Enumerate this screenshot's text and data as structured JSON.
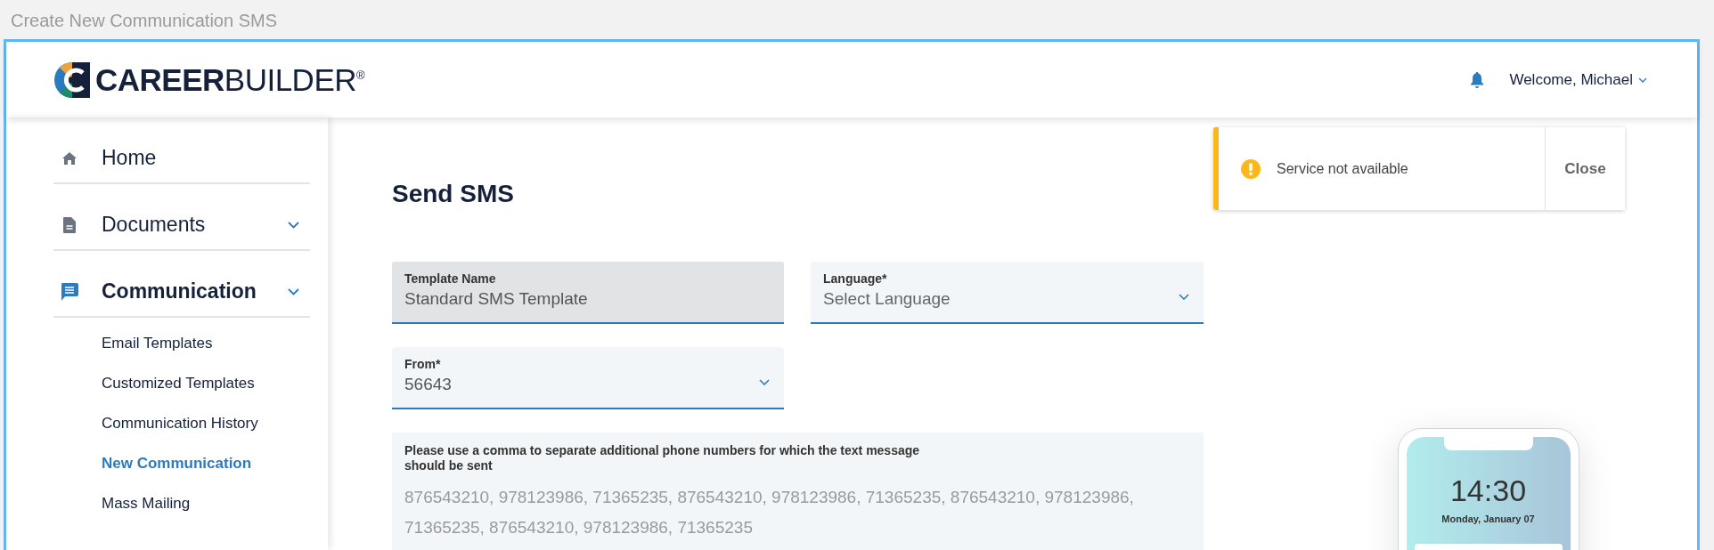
{
  "page_title": "Create New Communication SMS",
  "header": {
    "logo": {
      "bold": "CAREER",
      "light": "BUILDER",
      "mark": "®"
    },
    "user_menu": "Welcome, Michael"
  },
  "sidebar": {
    "items": [
      {
        "label": "Home",
        "kind": "home",
        "selected": false,
        "expandable": false
      },
      {
        "label": "Documents",
        "kind": "document",
        "selected": false,
        "expandable": true
      },
      {
        "label": "Communication",
        "kind": "chat",
        "selected": true,
        "expandable": true,
        "children": [
          {
            "label": "Email Templates",
            "selected": false
          },
          {
            "label": "Customized Templates",
            "selected": false
          },
          {
            "label": "Communication History",
            "selected": false
          },
          {
            "label": "New Communication",
            "selected": true
          },
          {
            "label": "Mass Mailing",
            "selected": false
          }
        ]
      }
    ]
  },
  "main": {
    "title": "Send SMS",
    "fields": [
      {
        "kind": "text",
        "label": "Template Name",
        "value": "Standard SMS Template",
        "disabled": true
      },
      {
        "kind": "select",
        "label": "Language*",
        "placeholder": "Select Language",
        "disabled": false
      },
      {
        "kind": "select",
        "label": "From*",
        "value": "56643",
        "disabled": false
      }
    ],
    "phone_numbers": {
      "label": "Please use a comma to separate additional phone numbers for which the text message\nshould be sent",
      "placeholder": "876543210, 978123986, 71365235, 876543210, 978123986, 71365235, 876543210, 978123986, 71365235, 876543210, 978123986, 71365235"
    }
  },
  "toast": {
    "message": "Service not available",
    "close_label": "Close"
  },
  "phone_preview": {
    "time": "14:30",
    "date": "Monday, January 07"
  }
}
